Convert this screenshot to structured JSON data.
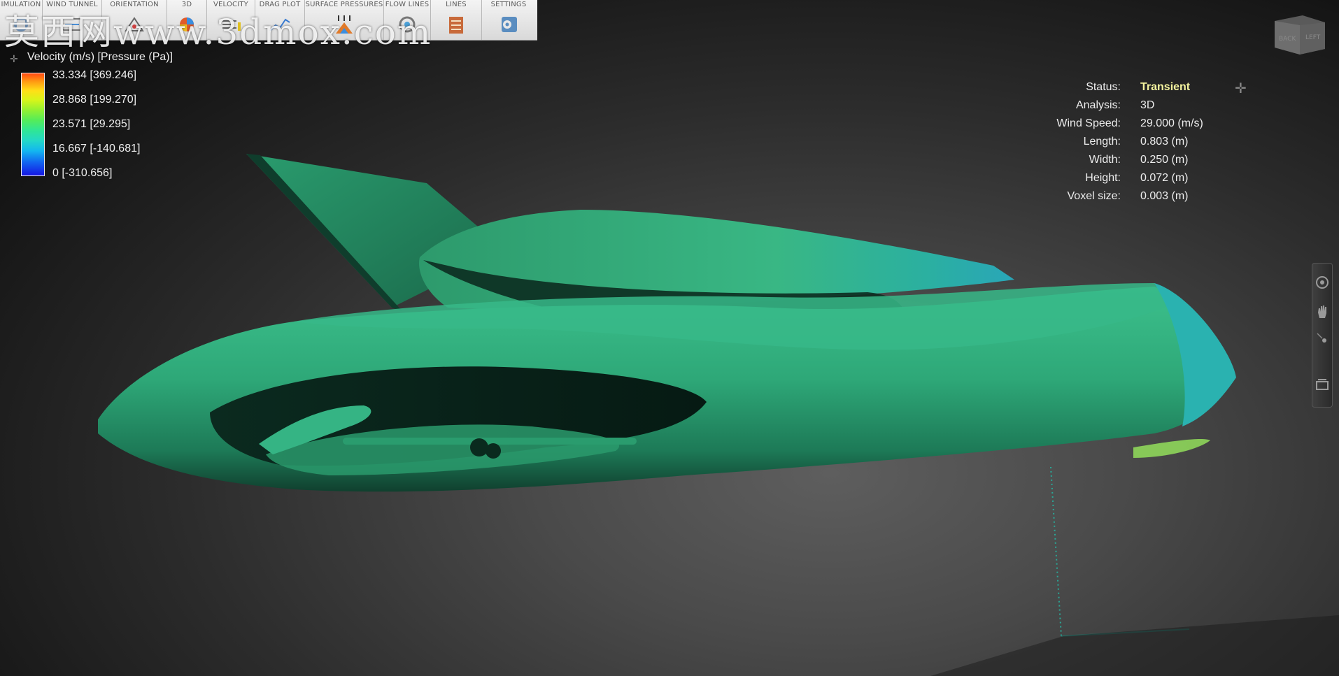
{
  "toolbar": {
    "groups": [
      {
        "label": "IMULATION",
        "icon": "simulation-icon"
      },
      {
        "label": "WIND TUNNEL",
        "icon": "wind-tunnel-icon"
      },
      {
        "label": "ORIENTATION",
        "icon": "orientation-icon"
      },
      {
        "label": "3D",
        "icon": "3d-icon"
      },
      {
        "label": "VELOCITY",
        "icon": "velocity-icon"
      },
      {
        "label": "DRAG PLOT",
        "icon": "drag-plot-icon"
      },
      {
        "label": "SURFACE PRESSURES",
        "icon": "surface-pressures-icon"
      },
      {
        "label": "FLOW LINES",
        "icon": "flow-lines-icon"
      },
      {
        "label": "LINES",
        "icon": "lines-icon"
      },
      {
        "label": "SETTINGS",
        "icon": "settings-icon"
      }
    ]
  },
  "watermark": "莫西网www.3dmox.com",
  "legend": {
    "title": "Velocity (m/s) [Pressure (Pa)]",
    "ticks": [
      "33.334 [369.246]",
      "28.868 [199.270]",
      "23.571 [29.295]",
      "16.667 [-140.681]",
      "0 [-310.656]"
    ]
  },
  "info": {
    "status_label": "Status:",
    "status_value": "Transient",
    "analysis_label": "Analysis:",
    "analysis_value": "3D",
    "wind_speed_label": "Wind Speed:",
    "wind_speed_value": "29.000 (m/s)",
    "length_label": "Length:",
    "length_value": "0.803 (m)",
    "width_label": "Width:",
    "width_value": "0.250 (m)",
    "height_label": "Height:",
    "height_value": "0.072 (m)",
    "voxel_label": "Voxel size:",
    "voxel_value": "0.003 (m)"
  },
  "viewcube": {
    "back": "BACK",
    "left": "LEFT"
  },
  "colors": {
    "status_accent": "#f4f39e",
    "model_green": "#2fa878",
    "background": "#2c2c2c"
  }
}
